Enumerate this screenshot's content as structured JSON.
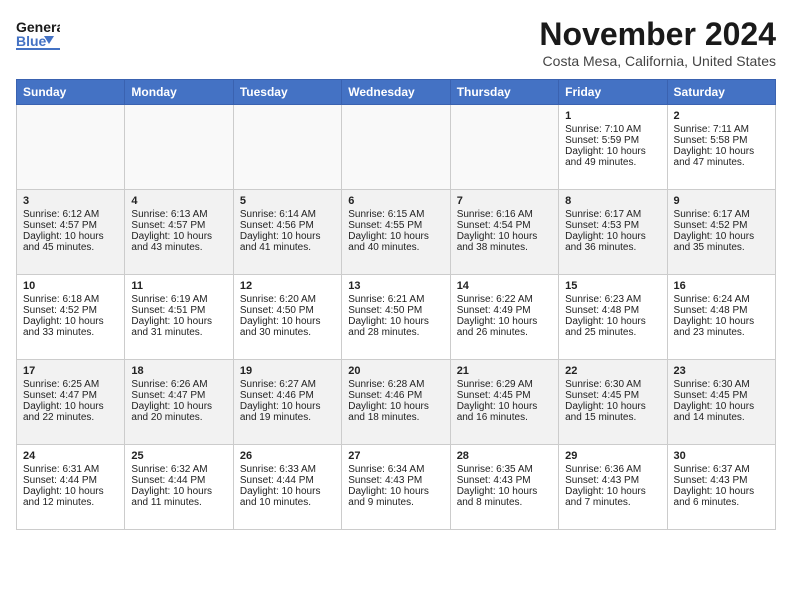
{
  "header": {
    "logo_general": "General",
    "logo_blue": "Blue",
    "month_title": "November 2024",
    "location": "Costa Mesa, California, United States"
  },
  "weekdays": [
    "Sunday",
    "Monday",
    "Tuesday",
    "Wednesday",
    "Thursday",
    "Friday",
    "Saturday"
  ],
  "weeks": [
    [
      {
        "day": "",
        "sunrise": "",
        "sunset": "",
        "daylight": ""
      },
      {
        "day": "",
        "sunrise": "",
        "sunset": "",
        "daylight": ""
      },
      {
        "day": "",
        "sunrise": "",
        "sunset": "",
        "daylight": ""
      },
      {
        "day": "",
        "sunrise": "",
        "sunset": "",
        "daylight": ""
      },
      {
        "day": "",
        "sunrise": "",
        "sunset": "",
        "daylight": ""
      },
      {
        "day": "1",
        "sunrise": "Sunrise: 7:10 AM",
        "sunset": "Sunset: 5:59 PM",
        "daylight": "Daylight: 10 hours and 49 minutes."
      },
      {
        "day": "2",
        "sunrise": "Sunrise: 7:11 AM",
        "sunset": "Sunset: 5:58 PM",
        "daylight": "Daylight: 10 hours and 47 minutes."
      }
    ],
    [
      {
        "day": "3",
        "sunrise": "Sunrise: 6:12 AM",
        "sunset": "Sunset: 4:57 PM",
        "daylight": "Daylight: 10 hours and 45 minutes."
      },
      {
        "day": "4",
        "sunrise": "Sunrise: 6:13 AM",
        "sunset": "Sunset: 4:57 PM",
        "daylight": "Daylight: 10 hours and 43 minutes."
      },
      {
        "day": "5",
        "sunrise": "Sunrise: 6:14 AM",
        "sunset": "Sunset: 4:56 PM",
        "daylight": "Daylight: 10 hours and 41 minutes."
      },
      {
        "day": "6",
        "sunrise": "Sunrise: 6:15 AM",
        "sunset": "Sunset: 4:55 PM",
        "daylight": "Daylight: 10 hours and 40 minutes."
      },
      {
        "day": "7",
        "sunrise": "Sunrise: 6:16 AM",
        "sunset": "Sunset: 4:54 PM",
        "daylight": "Daylight: 10 hours and 38 minutes."
      },
      {
        "day": "8",
        "sunrise": "Sunrise: 6:17 AM",
        "sunset": "Sunset: 4:53 PM",
        "daylight": "Daylight: 10 hours and 36 minutes."
      },
      {
        "day": "9",
        "sunrise": "Sunrise: 6:17 AM",
        "sunset": "Sunset: 4:52 PM",
        "daylight": "Daylight: 10 hours and 35 minutes."
      }
    ],
    [
      {
        "day": "10",
        "sunrise": "Sunrise: 6:18 AM",
        "sunset": "Sunset: 4:52 PM",
        "daylight": "Daylight: 10 hours and 33 minutes."
      },
      {
        "day": "11",
        "sunrise": "Sunrise: 6:19 AM",
        "sunset": "Sunset: 4:51 PM",
        "daylight": "Daylight: 10 hours and 31 minutes."
      },
      {
        "day": "12",
        "sunrise": "Sunrise: 6:20 AM",
        "sunset": "Sunset: 4:50 PM",
        "daylight": "Daylight: 10 hours and 30 minutes."
      },
      {
        "day": "13",
        "sunrise": "Sunrise: 6:21 AM",
        "sunset": "Sunset: 4:50 PM",
        "daylight": "Daylight: 10 hours and 28 minutes."
      },
      {
        "day": "14",
        "sunrise": "Sunrise: 6:22 AM",
        "sunset": "Sunset: 4:49 PM",
        "daylight": "Daylight: 10 hours and 26 minutes."
      },
      {
        "day": "15",
        "sunrise": "Sunrise: 6:23 AM",
        "sunset": "Sunset: 4:48 PM",
        "daylight": "Daylight: 10 hours and 25 minutes."
      },
      {
        "day": "16",
        "sunrise": "Sunrise: 6:24 AM",
        "sunset": "Sunset: 4:48 PM",
        "daylight": "Daylight: 10 hours and 23 minutes."
      }
    ],
    [
      {
        "day": "17",
        "sunrise": "Sunrise: 6:25 AM",
        "sunset": "Sunset: 4:47 PM",
        "daylight": "Daylight: 10 hours and 22 minutes."
      },
      {
        "day": "18",
        "sunrise": "Sunrise: 6:26 AM",
        "sunset": "Sunset: 4:47 PM",
        "daylight": "Daylight: 10 hours and 20 minutes."
      },
      {
        "day": "19",
        "sunrise": "Sunrise: 6:27 AM",
        "sunset": "Sunset: 4:46 PM",
        "daylight": "Daylight: 10 hours and 19 minutes."
      },
      {
        "day": "20",
        "sunrise": "Sunrise: 6:28 AM",
        "sunset": "Sunset: 4:46 PM",
        "daylight": "Daylight: 10 hours and 18 minutes."
      },
      {
        "day": "21",
        "sunrise": "Sunrise: 6:29 AM",
        "sunset": "Sunset: 4:45 PM",
        "daylight": "Daylight: 10 hours and 16 minutes."
      },
      {
        "day": "22",
        "sunrise": "Sunrise: 6:30 AM",
        "sunset": "Sunset: 4:45 PM",
        "daylight": "Daylight: 10 hours and 15 minutes."
      },
      {
        "day": "23",
        "sunrise": "Sunrise: 6:30 AM",
        "sunset": "Sunset: 4:45 PM",
        "daylight": "Daylight: 10 hours and 14 minutes."
      }
    ],
    [
      {
        "day": "24",
        "sunrise": "Sunrise: 6:31 AM",
        "sunset": "Sunset: 4:44 PM",
        "daylight": "Daylight: 10 hours and 12 minutes."
      },
      {
        "day": "25",
        "sunrise": "Sunrise: 6:32 AM",
        "sunset": "Sunset: 4:44 PM",
        "daylight": "Daylight: 10 hours and 11 minutes."
      },
      {
        "day": "26",
        "sunrise": "Sunrise: 6:33 AM",
        "sunset": "Sunset: 4:44 PM",
        "daylight": "Daylight: 10 hours and 10 minutes."
      },
      {
        "day": "27",
        "sunrise": "Sunrise: 6:34 AM",
        "sunset": "Sunset: 4:43 PM",
        "daylight": "Daylight: 10 hours and 9 minutes."
      },
      {
        "day": "28",
        "sunrise": "Sunrise: 6:35 AM",
        "sunset": "Sunset: 4:43 PM",
        "daylight": "Daylight: 10 hours and 8 minutes."
      },
      {
        "day": "29",
        "sunrise": "Sunrise: 6:36 AM",
        "sunset": "Sunset: 4:43 PM",
        "daylight": "Daylight: 10 hours and 7 minutes."
      },
      {
        "day": "30",
        "sunrise": "Sunrise: 6:37 AM",
        "sunset": "Sunset: 4:43 PM",
        "daylight": "Daylight: 10 hours and 6 minutes."
      }
    ]
  ]
}
